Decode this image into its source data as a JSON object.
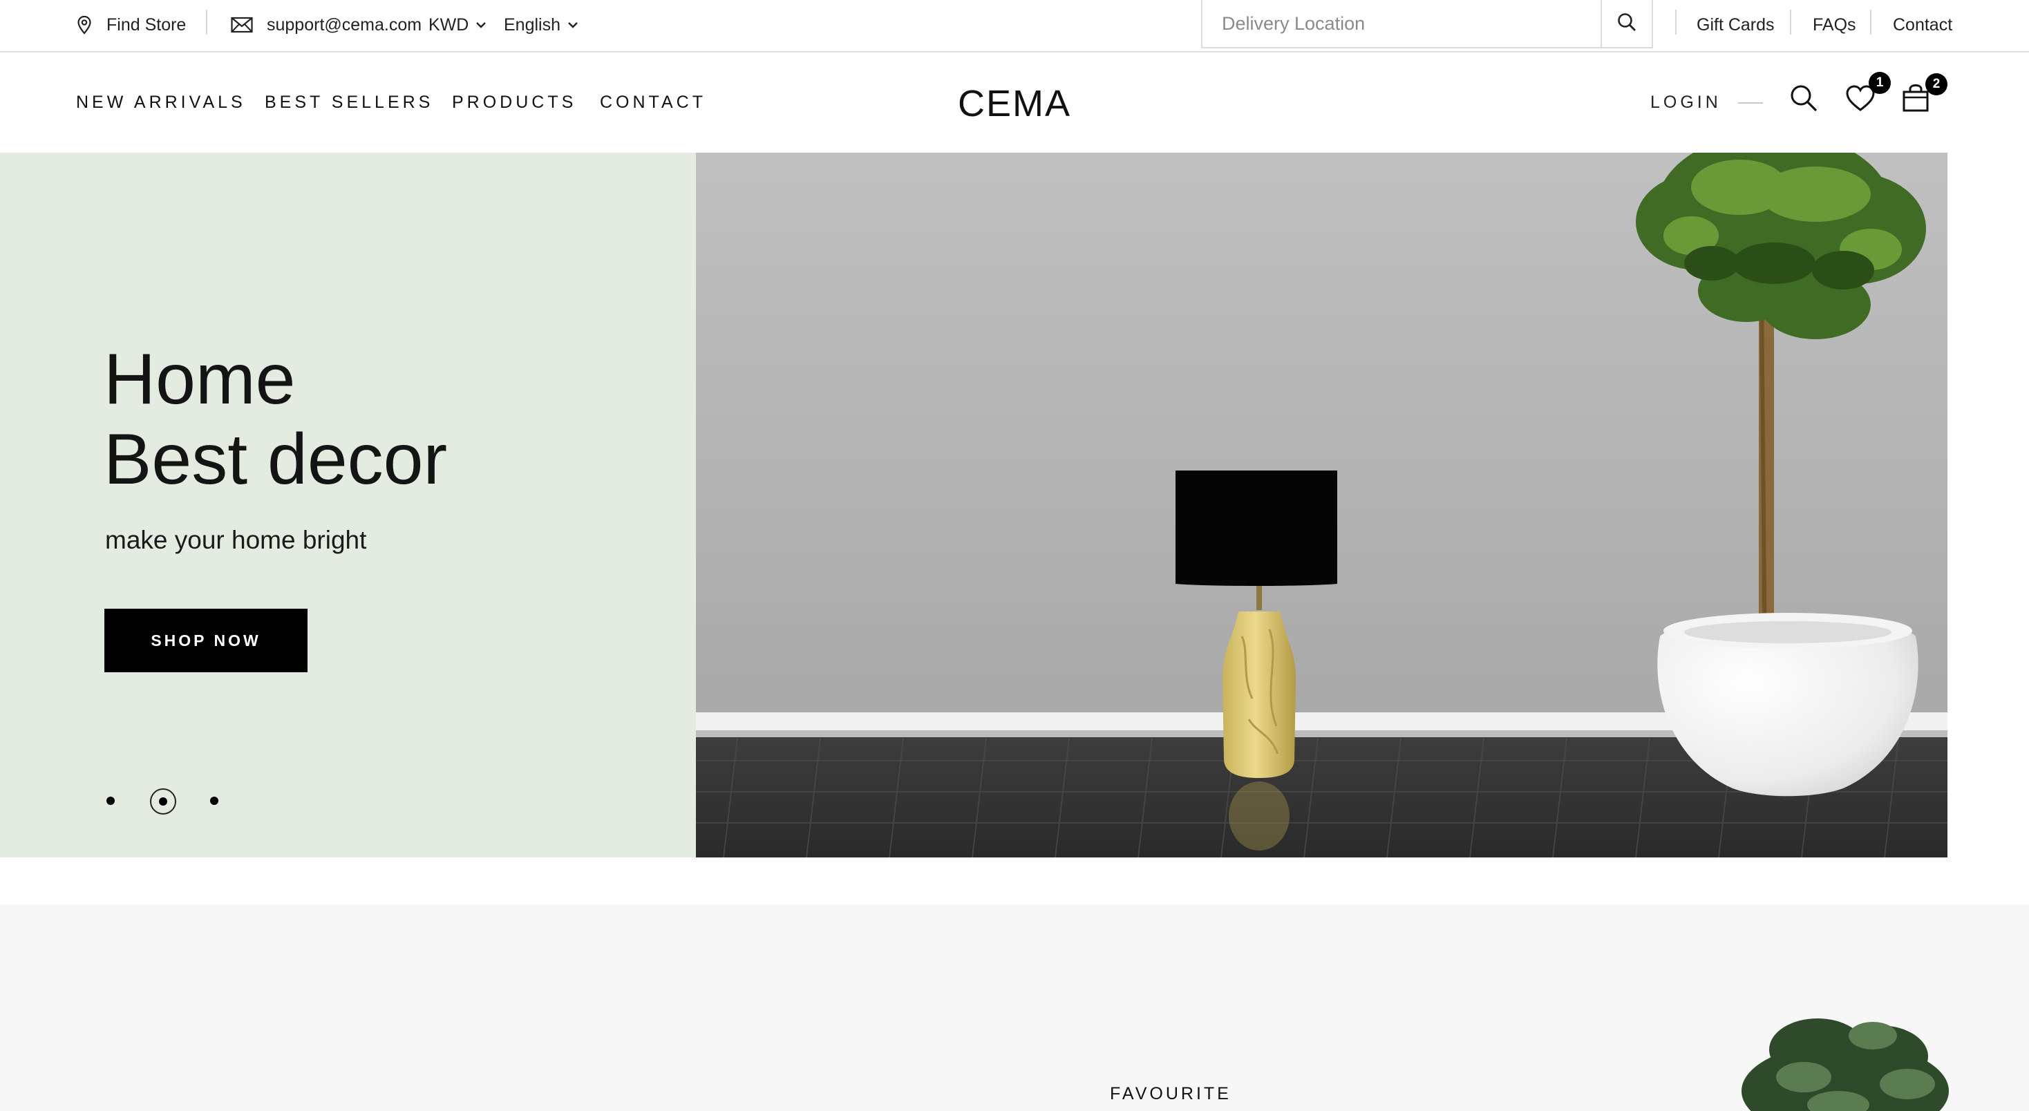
{
  "topbar": {
    "find_store": "Find Store",
    "email": "support@cema.com",
    "currency": "KWD",
    "language": "English",
    "search": {
      "placeholder": "Delivery Location"
    },
    "links": [
      "Gift Cards",
      "FAQs",
      "Contact"
    ]
  },
  "nav": {
    "links": [
      "NEW ARRIVALS",
      "BEST SELLERS",
      "PRODUCTS",
      "CONTACT"
    ],
    "logo": "CEMA",
    "login": "LOGIN",
    "wishlist_count": "1",
    "cart_count": "2"
  },
  "hero": {
    "title_line1": "Home",
    "title_line2": "Best decor",
    "subtitle": "make your home bright",
    "cta": "SHOP NOW",
    "slides_total": 3,
    "active_slide": 2,
    "bg_color": "#e4ece2"
  },
  "section": {
    "label": "FAVOURITE"
  },
  "colors": {
    "accent": "#000000",
    "hero_bg": "#e4ece2",
    "section_bg": "#f7f7f7"
  }
}
